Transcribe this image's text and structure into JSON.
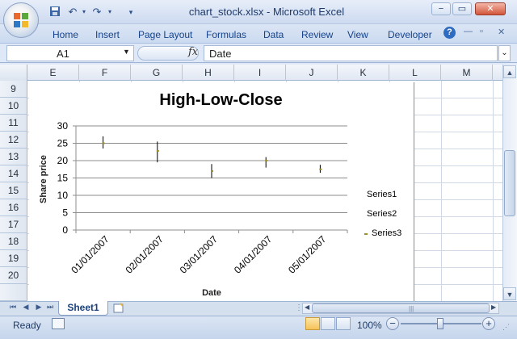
{
  "window": {
    "title": "chart_stock.xlsx - Microsoft Excel",
    "controls": {
      "minimize": "−",
      "restore": "▭",
      "close": "✕"
    }
  },
  "quick_access": {
    "save_icon": "save-icon",
    "undo_icon": "undo-icon",
    "redo_icon": "redo-icon",
    "customize_icon": "customize-icon"
  },
  "ribbon": {
    "tabs": [
      "Home",
      "Insert",
      "Page Layout",
      "Formulas",
      "Data",
      "Review",
      "View",
      "Developer"
    ]
  },
  "formula_bar": {
    "name_box": "A1",
    "fx": "fx",
    "formula": "Date"
  },
  "columns": [
    "E",
    "F",
    "G",
    "H",
    "I",
    "J",
    "K",
    "L",
    "M"
  ],
  "rows": [
    "9",
    "10",
    "11",
    "12",
    "13",
    "14",
    "15",
    "16",
    "17",
    "18",
    "19",
    "20"
  ],
  "chart_data": {
    "type": "stock",
    "title": "High-Low-Close",
    "xlabel": "Date",
    "ylabel": "Share price",
    "categories": [
      "01/01/2007",
      "02/01/2007",
      "03/01/2007",
      "04/01/2007",
      "05/01/2007"
    ],
    "series": [
      {
        "name": "Series1",
        "values": [
          27,
          25.5,
          19,
          21,
          18.8
        ]
      },
      {
        "name": "Series2",
        "values": [
          23.5,
          19.5,
          15,
          18,
          16.5
        ]
      },
      {
        "name": "Series3",
        "values": [
          25,
          22.8,
          17,
          20,
          17.5
        ]
      }
    ],
    "ylim": [
      0,
      30
    ],
    "yticks": [
      "0",
      "5",
      "10",
      "15",
      "20",
      "25",
      "30"
    ],
    "grid": true,
    "legend": "right",
    "colors": {
      "hilo": "#000000",
      "close": "#9b8f2c"
    }
  },
  "sheet_tabs": [
    "Sheet1"
  ],
  "status": {
    "text": "Ready",
    "zoom": "100%",
    "zoom_minus": "−",
    "zoom_plus": "+"
  }
}
